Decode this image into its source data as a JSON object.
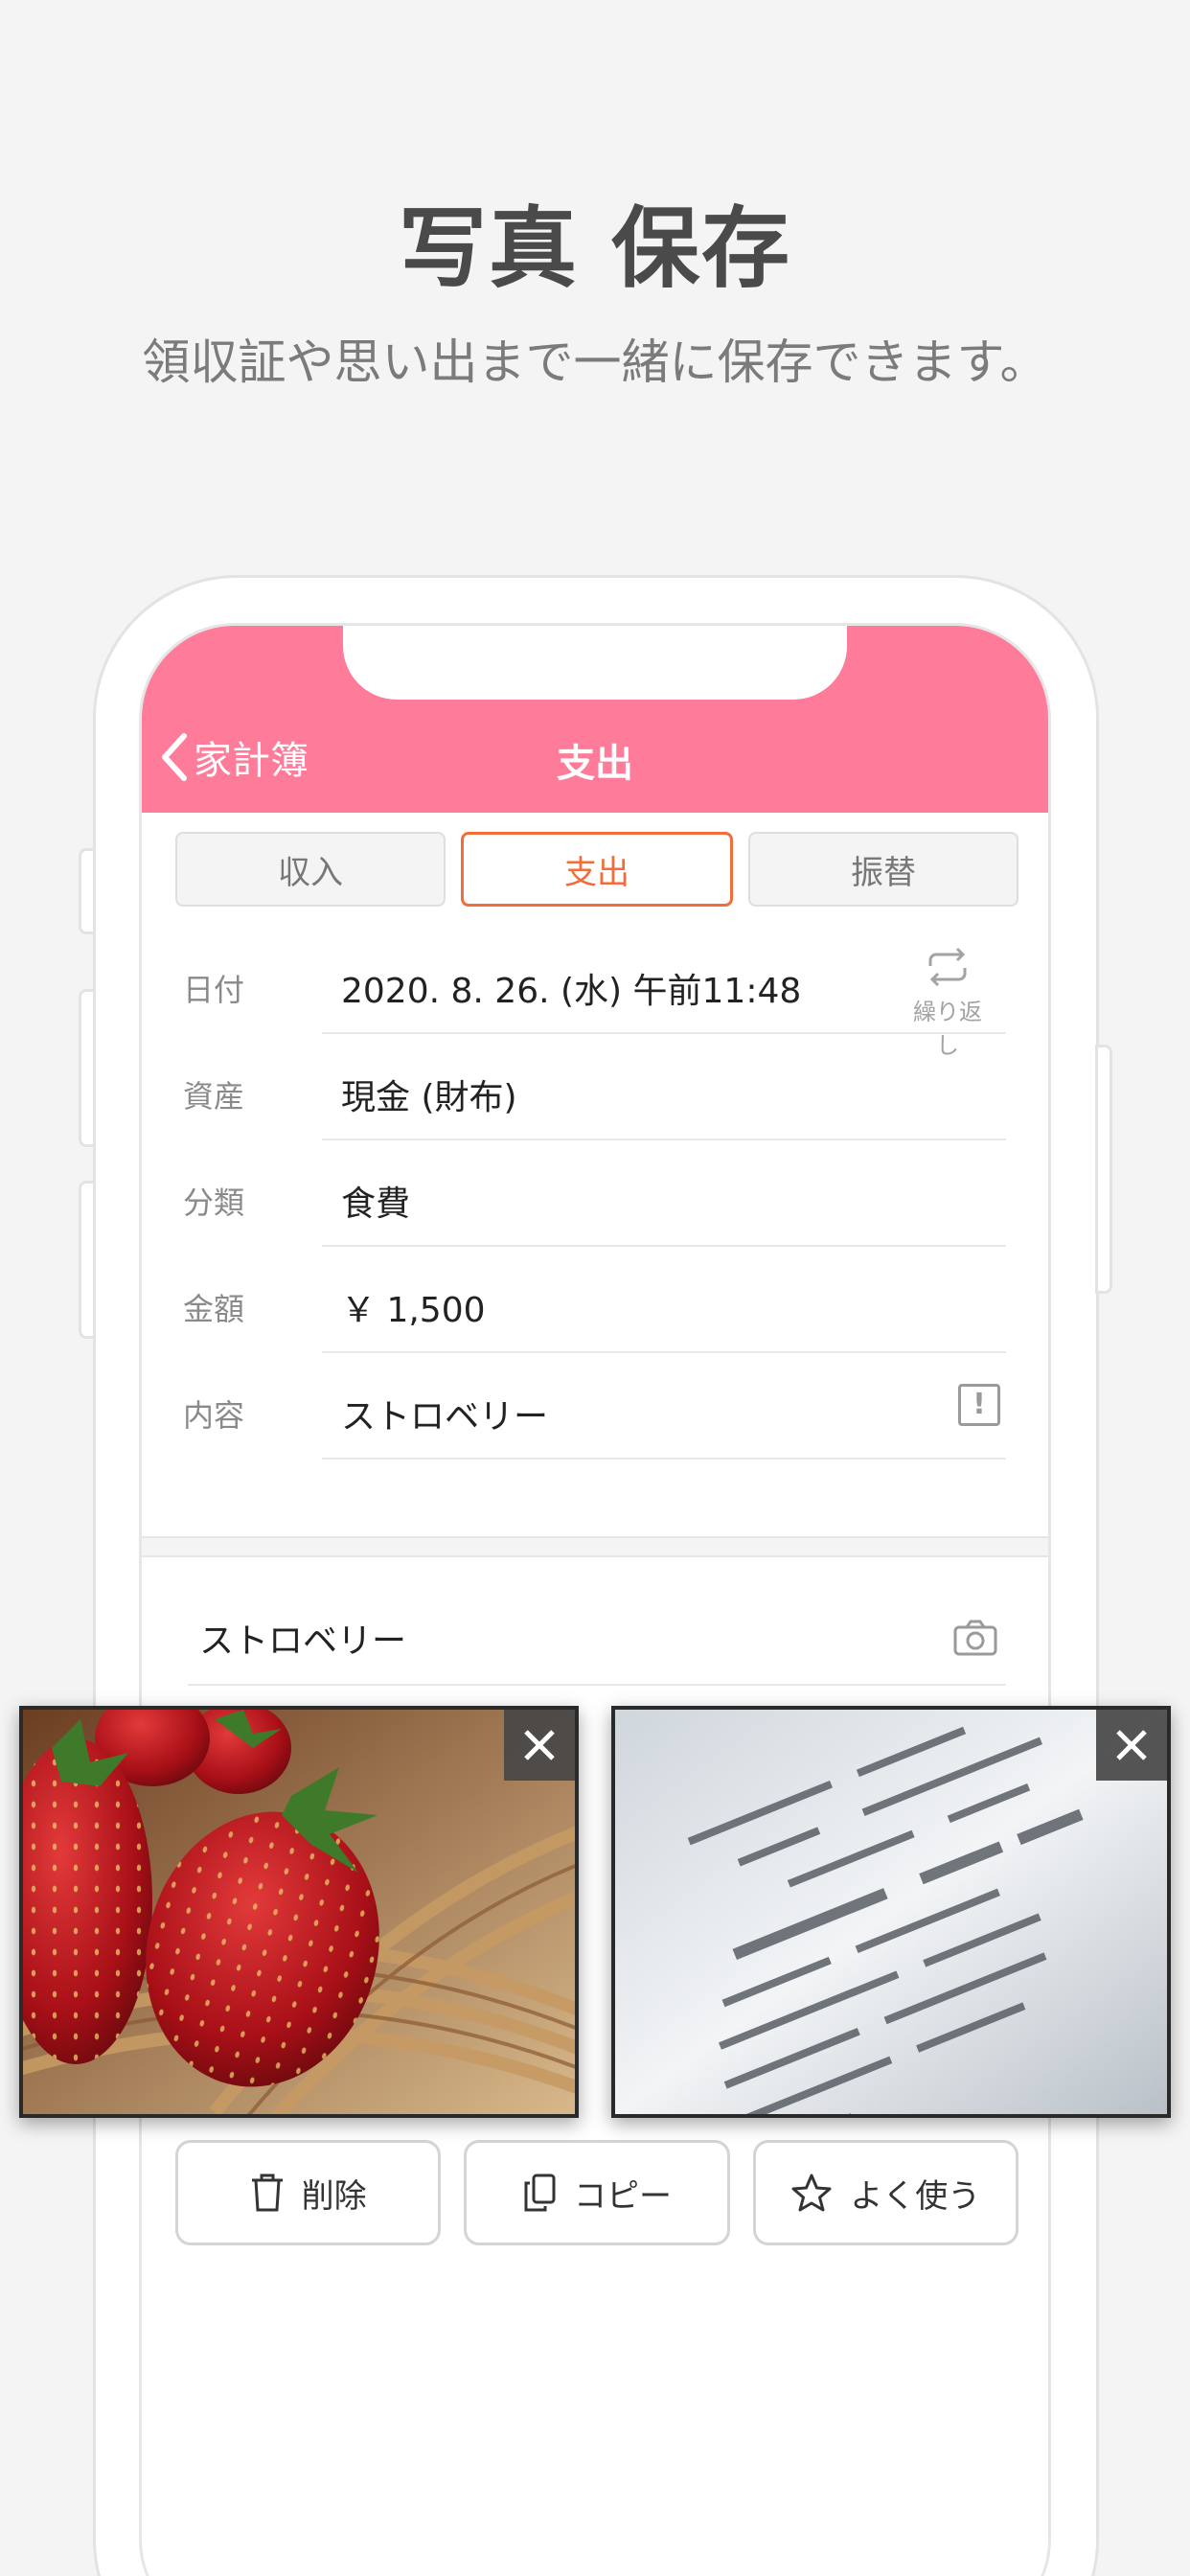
{
  "promo": {
    "title": "写真 保存",
    "subtitle": "領収証や思い出まで一緒に保存できます。"
  },
  "nav": {
    "back_label": "家計簿",
    "title": "支出",
    "color": "#fe7b9a"
  },
  "segments": [
    {
      "label": "収入",
      "active": false
    },
    {
      "label": "支出",
      "active": true
    },
    {
      "label": "振替",
      "active": false
    }
  ],
  "form": {
    "date": {
      "label": "日付",
      "value": "2020. 8. 26. (水)   午前11:48",
      "repeat_label": "繰り返し"
    },
    "asset": {
      "label": "資産",
      "value": "現金 (財布)"
    },
    "category": {
      "label": "分類",
      "value": "食費"
    },
    "amount": {
      "label": "金額",
      "value": "￥ 1,500"
    },
    "content": {
      "label": "内容",
      "value": "ストロベリー"
    }
  },
  "memo": {
    "value": "ストロベリー"
  },
  "actions": {
    "delete_label": "削除",
    "copy_label": "コピー",
    "favorite_label": "よく使う"
  },
  "photos": [
    {
      "name": "strawberries-photo"
    },
    {
      "name": "receipt-photo"
    }
  ],
  "colors": {
    "accent": "#f36d3b",
    "background": "#f4f4f5"
  }
}
